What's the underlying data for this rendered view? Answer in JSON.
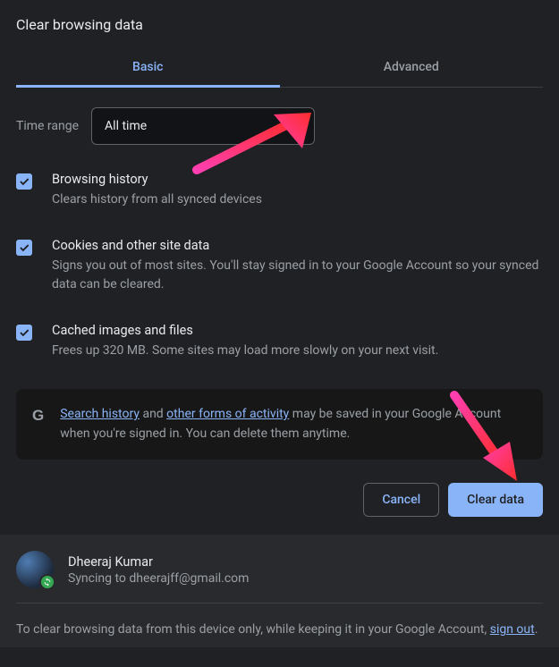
{
  "title": "Clear browsing data",
  "tabs": {
    "basic": "Basic",
    "advanced": "Advanced"
  },
  "time_range": {
    "label": "Time range",
    "value": "All time"
  },
  "options": {
    "history": {
      "title": "Browsing history",
      "desc": "Clears history from all synced devices"
    },
    "cookies": {
      "title": "Cookies and other site data",
      "desc": "Signs you out of most sites. You'll stay signed in to your Google Account so your synced data can be cleared."
    },
    "cache": {
      "title": "Cached images and files",
      "desc": "Frees up 320 MB. Some sites may load more slowly on your next visit."
    }
  },
  "info": {
    "link1": "Search history",
    "mid1": " and ",
    "link2": "other forms of activity",
    "tail": " may be saved in your Google Account when you're signed in. You can delete them anytime."
  },
  "buttons": {
    "cancel": "Cancel",
    "clear": "Clear data"
  },
  "account": {
    "name": "Dheeraj Kumar",
    "sync": "Syncing to dheerajff@gmail.com"
  },
  "footer": {
    "pre": "To clear browsing data from this device only, while keeping it in your Google Account, ",
    "link": "sign out",
    "post": "."
  }
}
